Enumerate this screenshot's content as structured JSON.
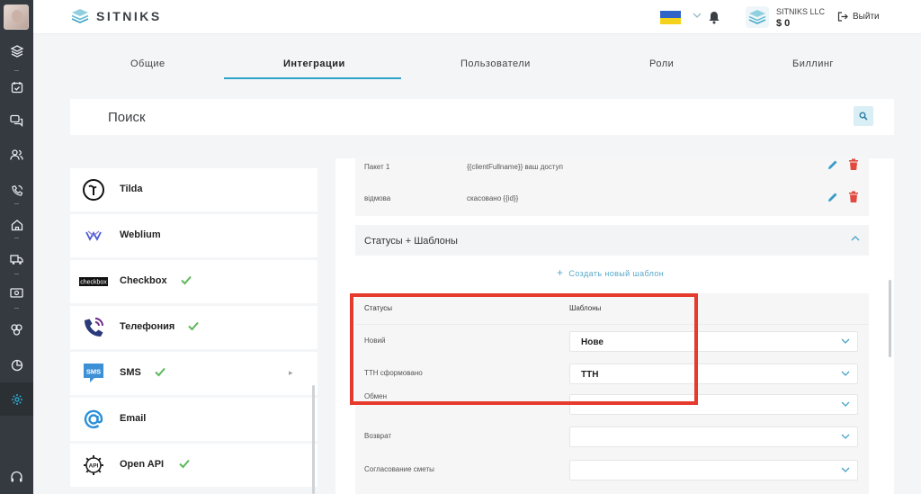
{
  "header": {
    "logo_text": "SITNIKS",
    "account_name": "SITNIKS LLC",
    "account_balance": "$ 0",
    "logout_label": "Выйти"
  },
  "tabs": [
    {
      "label": "Общие"
    },
    {
      "label": "Интеграции",
      "active": true
    },
    {
      "label": "Пользователи"
    },
    {
      "label": "Роли"
    },
    {
      "label": "Биллинг"
    }
  ],
  "search": {
    "label": "Поиск"
  },
  "integrations": [
    {
      "name": "Tilda",
      "icon": "tilda-icon",
      "connected": false
    },
    {
      "name": "Weblium",
      "icon": "weblium-icon",
      "connected": false
    },
    {
      "name": "Checkbox",
      "icon": "checkbox-logo-icon",
      "icon_text": "checkbox",
      "connected": true
    },
    {
      "name": "Телефония",
      "icon": "phone-icon",
      "connected": true
    },
    {
      "name": "SMS",
      "icon": "sms-icon",
      "icon_text": "SMS",
      "connected": true
    },
    {
      "name": "Email",
      "icon": "email-at-icon",
      "connected": false
    },
    {
      "name": "Open API",
      "icon": "api-gear-icon",
      "icon_text": "API",
      "connected": true
    }
  ],
  "templates": [
    {
      "name": "Пакет 1",
      "text": "{{clientFullname}} ваш доступ"
    },
    {
      "name": "відмова",
      "text": "скасовано {{id}}"
    }
  ],
  "statuses_section": {
    "title": "Статусы + Шаблоны",
    "create_label": "Создать новый шаблон",
    "col_status": "Статусы",
    "col_template": "Шаблоны",
    "rows": [
      {
        "status": "Новий",
        "template": "Нове"
      },
      {
        "status": "ТТН сформовано",
        "template": "ТТН"
      },
      {
        "status": "Обмен",
        "template": ""
      },
      {
        "status": "Возврат",
        "template": ""
      },
      {
        "status": "Согласование сметы",
        "template": ""
      }
    ]
  },
  "colors": {
    "sidebar_bg": "#343a40",
    "accent": "#2ea3c9",
    "highlight": "#e53a2c",
    "check": "#5cb85c",
    "delete": "#e04a3f"
  }
}
